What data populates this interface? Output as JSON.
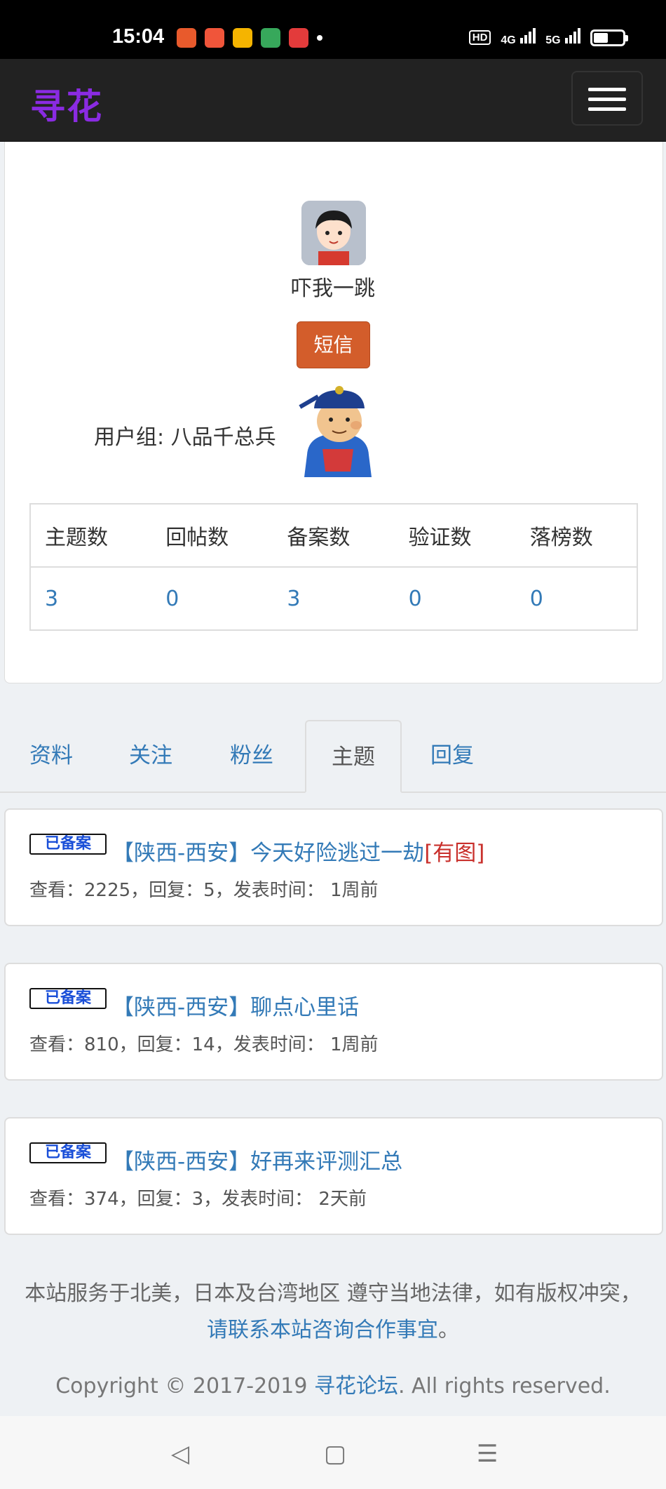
{
  "status_bar": {
    "time": "15:04",
    "network_labels": [
      "HD",
      "4G",
      "5G"
    ],
    "app_icon_colors": [
      "#e85a2c",
      "#f0553a",
      "#f5b400",
      "#37a85b",
      "#e33b3b"
    ]
  },
  "navbar": {
    "brand": "寻花",
    "brand_color": "#8a2be2",
    "menu_icon": "hamburger-menu-icon"
  },
  "profile": {
    "username": "吓我一跳",
    "sms_button": "短信",
    "group_label": "用户组: 八品千总兵",
    "stats_headers": [
      "主题数",
      "回帖数",
      "备案数",
      "验证数",
      "落榜数"
    ],
    "stats_values": [
      "3",
      "0",
      "3",
      "0",
      "0"
    ]
  },
  "tabs": [
    {
      "label": "资料",
      "active": false
    },
    {
      "label": "关注",
      "active": false
    },
    {
      "label": "粉丝",
      "active": false
    },
    {
      "label": "主题",
      "active": true
    },
    {
      "label": "回复",
      "active": false
    }
  ],
  "topics": [
    {
      "badge": "已备案",
      "title": "【陕西-西安】今天好险逃过一劫",
      "pic_tag": "[有图]",
      "meta": "查看：2225，回复：5，发表时间：  1周前"
    },
    {
      "badge": "已备案",
      "title": "【陕西-西安】聊点心里话",
      "pic_tag": "",
      "meta": "查看：810，回复：14，发表时间：  1周前"
    },
    {
      "badge": "已备案",
      "title": "【陕西-西安】好再来评测汇总",
      "pic_tag": "",
      "meta": "查看：374，回复：3，发表时间：  2天前"
    }
  ],
  "footer": {
    "note": "本站服务于北美，日本及台湾地区 遵守当地法律，如有版权冲突，",
    "contact_link": "请联系本站咨询合作事宜",
    "note_end": "。",
    "copyright_prefix": "Copyright © 2017-2019 ",
    "copyright_link": "寻花论坛",
    "copyright_suffix": ". All rights reserved."
  },
  "system_nav": {
    "back": "◁",
    "home": "▢",
    "menu": "☰"
  },
  "colors": {
    "link": "#337ab7",
    "sms_button": "#d35d2b",
    "tag_red": "#c9302c",
    "navbar_bg": "#222222"
  }
}
